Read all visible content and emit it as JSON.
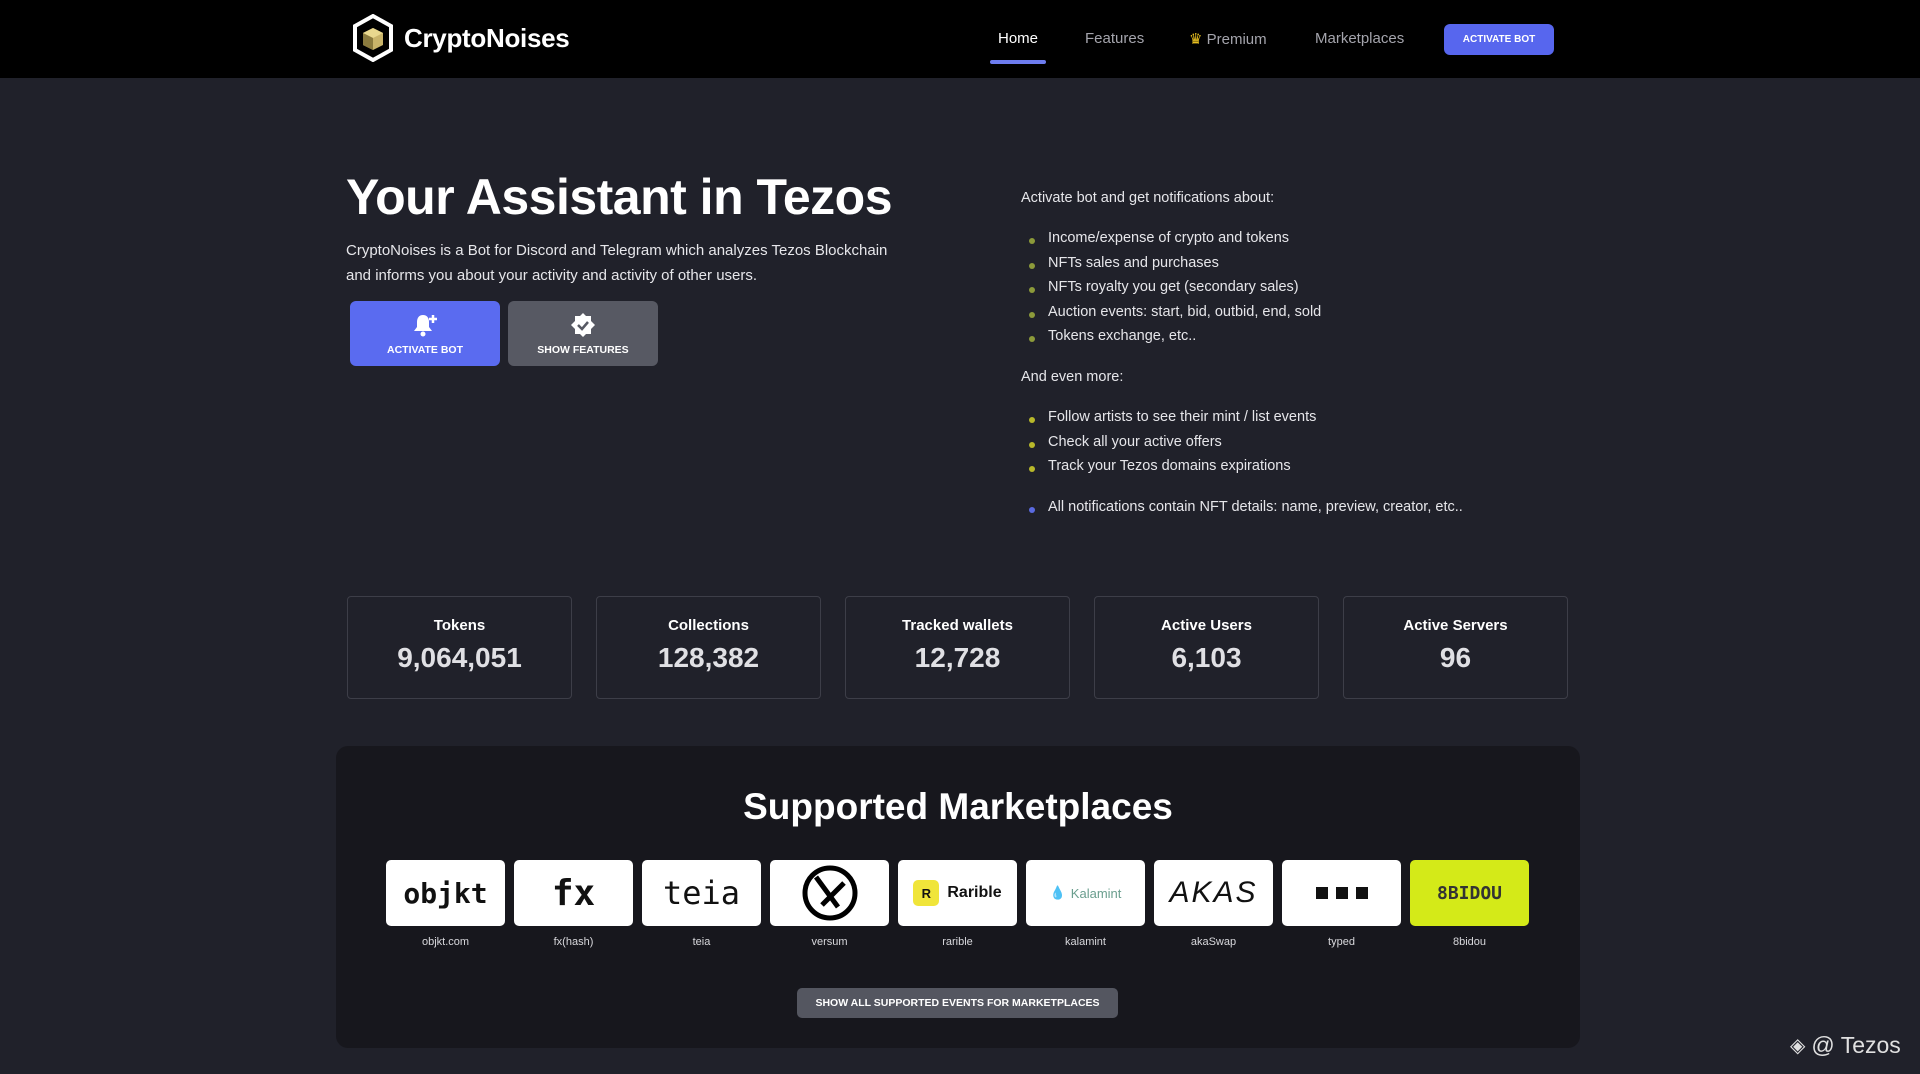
{
  "nav": {
    "brand": "CryptoNoises",
    "links": [
      "Home",
      "Features",
      "Premium",
      "Marketplaces"
    ],
    "activate": "ACTIVATE BOT"
  },
  "hero": {
    "title": "Your Assistant in Tezos",
    "lead": "CryptoNoises is a Bot for Discord and Telegram which analyzes Tezos Blockchain and informs you about your activity and activity of other users.",
    "btn_activate": "ACTIVATE BOT",
    "btn_features": "SHOW FEATURES"
  },
  "notifications": {
    "intro": "Activate bot and get notifications about:",
    "items": [
      "Income/expense of crypto and tokens",
      "NFTs sales and purchases",
      "NFTs royalty you get (secondary sales)",
      "Auction events: start, bid, outbid, end, sold",
      "Tokens exchange, etc.."
    ],
    "more": "And even more:",
    "more_items": [
      "Follow artists to see their mint / list events",
      "Check all your active offers",
      "Track your Tezos domains expirations"
    ],
    "note": "All notifications contain NFT details: name, preview, creator, etc.."
  },
  "stats": [
    {
      "label": "Tokens",
      "value": "9,064,051"
    },
    {
      "label": "Collections",
      "value": "128,382"
    },
    {
      "label": "Tracked wallets",
      "value": "12,728"
    },
    {
      "label": "Active Users",
      "value": "6,103"
    },
    {
      "label": "Active Servers",
      "value": "96"
    }
  ],
  "marketplaces": {
    "title": "Supported Marketplaces",
    "items": [
      {
        "logo": "objkt",
        "label": "objkt.com"
      },
      {
        "logo": "fx",
        "label": "fx(hash)"
      },
      {
        "logo": "teia",
        "label": "teia"
      },
      {
        "logo": "",
        "label": "versum"
      },
      {
        "logo": "Rarible",
        "label": "rarible"
      },
      {
        "logo": "Kalamint",
        "label": "kalamint"
      },
      {
        "logo": "AKAS",
        "label": "akaSwap"
      },
      {
        "logo": "",
        "label": "typed"
      },
      {
        "logo": "8BIDOU",
        "label": "8bidou"
      }
    ],
    "show_all": "SHOW ALL SUPPORTED EVENTS FOR MARKETPLACES"
  },
  "watermark": "@ Tezos",
  "colors": {
    "accent": "#5766ee",
    "bullet1": "#8c9a3a",
    "bullet2": "#b8b82a",
    "bullet3": "#5a6ae0"
  }
}
